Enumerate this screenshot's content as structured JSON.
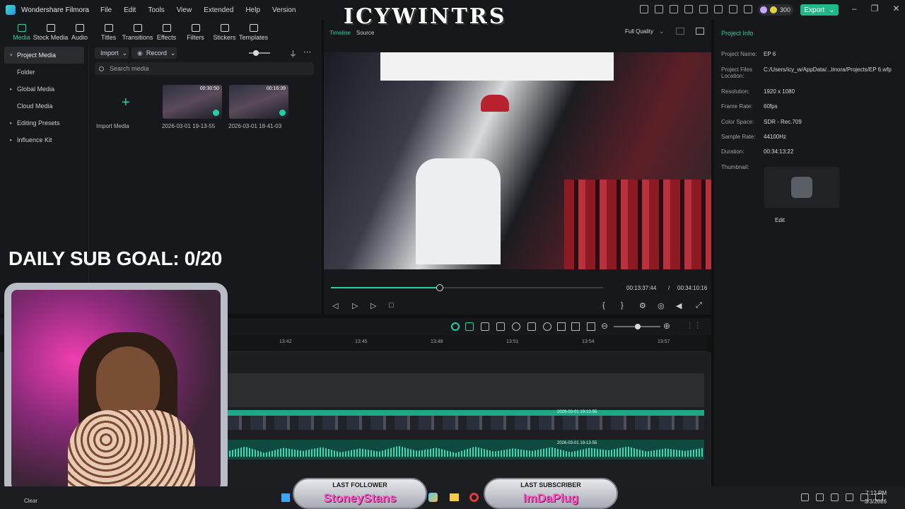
{
  "app": {
    "name": "Wondershare Filmora"
  },
  "menu": [
    "File",
    "Edit",
    "Tools",
    "View",
    "Extended",
    "Help",
    "Version"
  ],
  "credits": "300",
  "export_label": "Export",
  "toolbar": [
    "Media",
    "Stock Media",
    "Audio",
    "Titles",
    "Transitions",
    "Effects",
    "Filters",
    "Stickers",
    "Templates"
  ],
  "sidebar": [
    {
      "label": "Project Media",
      "active": true
    },
    {
      "label": "Folder"
    },
    {
      "label": "Global Media"
    },
    {
      "label": "Cloud Media"
    },
    {
      "label": "Editing Presets"
    },
    {
      "label": "Influence Kit"
    }
  ],
  "media": {
    "import_label": "Import",
    "record_label": "Record",
    "search_placeholder": "Search media",
    "import_media_label": "Import Media",
    "items": [
      {
        "name": "2026-03-01 19-13-55",
        "duration": "00:30:50"
      },
      {
        "name": "2026-03-01 18-41-03",
        "duration": "00:16:39"
      }
    ]
  },
  "preview": {
    "tabs": [
      "Timeline",
      "Source"
    ],
    "quality": "Full Quality",
    "current_time": "00:13:37:44",
    "separator": "/",
    "total_time": "00:34:10:16",
    "progress": 0.4
  },
  "project_info": {
    "heading": "Project Info",
    "rows": [
      {
        "label": "Project Name:",
        "value": "EP 6"
      },
      {
        "label": "Project Files Location:",
        "value": "C:/Users/icy_w/AppData/...lmora/Projects/EP 6.wfp"
      },
      {
        "label": "Resolution:",
        "value": "1920 x 1080"
      },
      {
        "label": "Frame Rate:",
        "value": "60fps"
      },
      {
        "label": "Color Space:",
        "value": "SDR - Rec.709"
      },
      {
        "label": "Sample Rate:",
        "value": "44100Hz"
      },
      {
        "label": "Duration:",
        "value": "00:34:13:22"
      },
      {
        "label": "Thumbnail:",
        "value": ""
      }
    ],
    "edit_label": "Edit"
  },
  "timeline": {
    "ticks": [
      "13:42",
      "13:45",
      "13:48",
      "13:51",
      "13:54",
      "13:57"
    ],
    "video_clip": "2026-03-01 19-13-55",
    "audio_clip": "2026-03-01 19-13-55"
  },
  "overlay": {
    "channel_name": "ICYWINTRS",
    "sub_goal": "DAILY SUB GOAL: 0/20",
    "last_follower_title": "LAST FOLLOWER",
    "last_follower_name": "StoneyStans",
    "last_subscriber_title": "LAST SUBSCRIBER",
    "last_subscriber_name": "ImDaPlug"
  },
  "taskbar": {
    "clear_label": "Clear",
    "time": "7:12 PM",
    "date": "3/3/2026"
  },
  "colors": {
    "accent": "#1ed2a8",
    "export": "#1fb88a"
  }
}
